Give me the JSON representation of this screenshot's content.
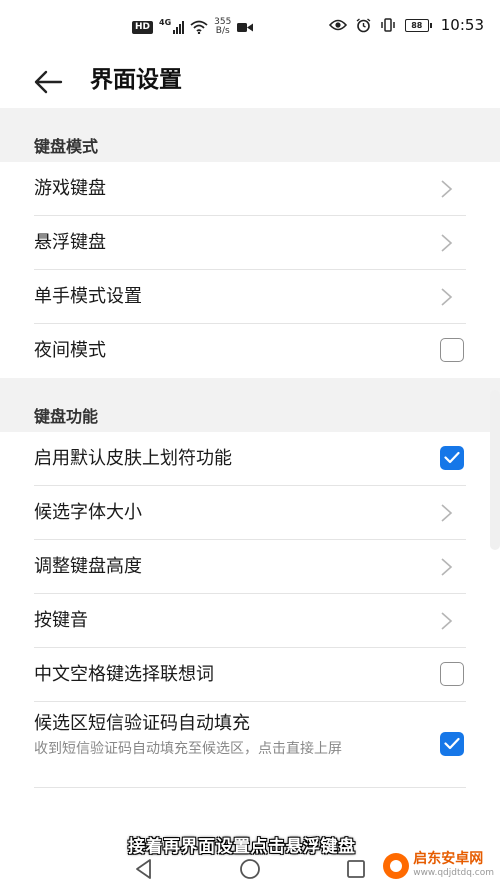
{
  "status_bar": {
    "hd_badge": "HD",
    "network": "4G",
    "speed_value": "355",
    "speed_unit": "B/s",
    "battery": "88",
    "time": "10:53"
  },
  "header": {
    "title": "界面设置"
  },
  "sections": [
    {
      "title": "键盘模式",
      "rows": [
        {
          "label": "游戏键盘",
          "control": "chevron"
        },
        {
          "label": "悬浮键盘",
          "control": "chevron"
        },
        {
          "label": "单手模式设置",
          "control": "chevron"
        },
        {
          "label": "夜间模式",
          "control": "checkbox",
          "checked": false
        }
      ]
    },
    {
      "title": "键盘功能",
      "rows": [
        {
          "label": "启用默认皮肤上划符功能",
          "control": "checkbox",
          "checked": true
        },
        {
          "label": "候选字体大小",
          "control": "chevron"
        },
        {
          "label": "调整键盘高度",
          "control": "chevron"
        },
        {
          "label": "按键音",
          "control": "chevron"
        },
        {
          "label": "中文空格键选择联想词",
          "control": "checkbox",
          "checked": false
        },
        {
          "label": "候选区短信验证码自动填充",
          "sublabel": "收到短信验证码自动填充至候选区，点击直接上屏",
          "control": "checkbox",
          "checked": true
        }
      ]
    }
  ],
  "caption": "接着再界面设置点击悬浮键盘",
  "watermark": {
    "title": "启东安卓网",
    "url": "www.qdjdtdq.com"
  },
  "colors": {
    "accent": "#1677e8",
    "section_bg": "#f2f2f2",
    "watermark": "#ff6a00"
  },
  "icons": {
    "back": "arrow-left-icon",
    "chevron": "chevron-right-icon",
    "nav_back": "triangle-back-icon",
    "nav_home": "circle-home-icon",
    "nav_recent": "square-recent-icon"
  }
}
